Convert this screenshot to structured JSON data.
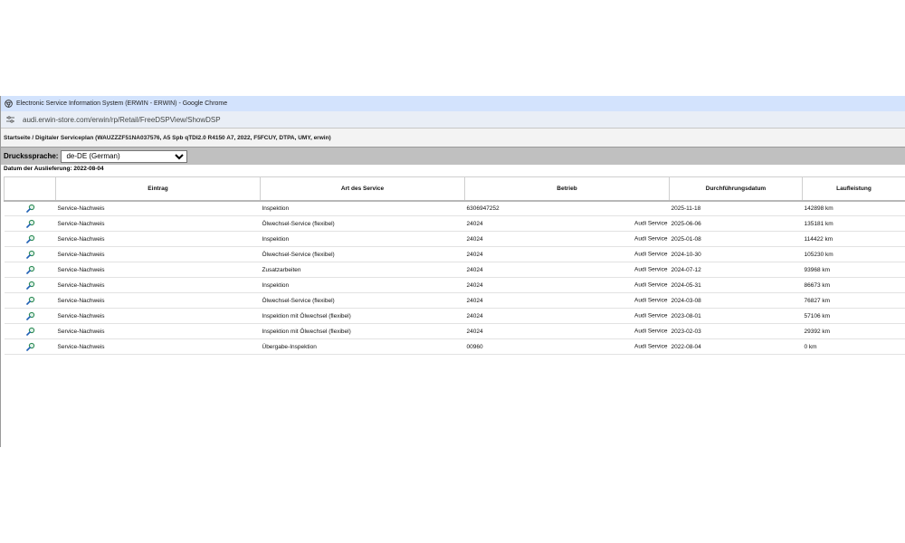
{
  "window": {
    "title": "Electronic Service Information System (ERWIN - ERWIN) - Google Chrome",
    "url": "audi.erwin-store.com/erwin/rp/Retail/FreeDSPView/ShowDSP"
  },
  "breadcrumb": "Startseite / Digitaler Serviceplan (WAUZZZF51NA037576, A5 Spb qTDI2.0 R4150 A7, 2022, F5FCUY, DTPA, UMY, erwin)",
  "print_language": {
    "label": "Druckssprache:",
    "selected": "de-DE (German)"
  },
  "delivery_date": "Datum der Auslieferung: 2022-08-04",
  "table": {
    "headers": [
      "",
      "Eintrag",
      "Art des Service",
      "Betrieb",
      "Durchführungsdatum",
      "Laufleistung"
    ],
    "rows": [
      {
        "entry": "Service-Nachweis",
        "service": "Inspektion",
        "betrieb": "6306947252",
        "org": "",
        "date": "2025-11-18",
        "mileage": "142898 km"
      },
      {
        "entry": "Service-Nachweis",
        "service": "Ölwechsel-Service (flexibel)",
        "betrieb": "24024",
        "org": "Audi Service",
        "date": "2025-06-06",
        "mileage": "135181 km"
      },
      {
        "entry": "Service-Nachweis",
        "service": "Inspektion",
        "betrieb": "24024",
        "org": "Audi Service",
        "date": "2025-01-08",
        "mileage": "114422 km"
      },
      {
        "entry": "Service-Nachweis",
        "service": "Ölwechsel-Service (flexibel)",
        "betrieb": "24024",
        "org": "Audi Service",
        "date": "2024-10-30",
        "mileage": "105230 km"
      },
      {
        "entry": "Service-Nachweis",
        "service": "Zusatzarbeiten",
        "betrieb": "24024",
        "org": "Audi Service",
        "date": "2024-07-12",
        "mileage": "93968 km"
      },
      {
        "entry": "Service-Nachweis",
        "service": "Inspektion",
        "betrieb": "24024",
        "org": "Audi Service",
        "date": "2024-05-31",
        "mileage": "86673 km"
      },
      {
        "entry": "Service-Nachweis",
        "service": "Ölwechsel-Service (flexibel)",
        "betrieb": "24024",
        "org": "Audi Service",
        "date": "2024-03-08",
        "mileage": "76827 km"
      },
      {
        "entry": "Service-Nachweis",
        "service": "Inspektion mit Ölwechsel (flexibel)",
        "betrieb": "24024",
        "org": "Audi Service",
        "date": "2023-08-01",
        "mileage": "57106 km"
      },
      {
        "entry": "Service-Nachweis",
        "service": "Inspektion mit Ölwechsel (flexibel)",
        "betrieb": "24024",
        "org": "Audi Service",
        "date": "2023-02-03",
        "mileage": "29392 km"
      },
      {
        "entry": "Service-Nachweis",
        "service": "Übergabe-Inspektion",
        "betrieb": "00960",
        "org": "Audi Service",
        "date": "2022-08-04",
        "mileage": "0 km"
      }
    ]
  },
  "icons": {
    "row_action": "magnifier-icon",
    "tab": "chrome-logo-icon",
    "site_info": "tune-icon"
  },
  "colors": {
    "titlebar": "#d3e3fd",
    "printbar": "#c0c0c0",
    "icon_green": "#2e8b57",
    "icon_blue": "#1e5fb4"
  }
}
